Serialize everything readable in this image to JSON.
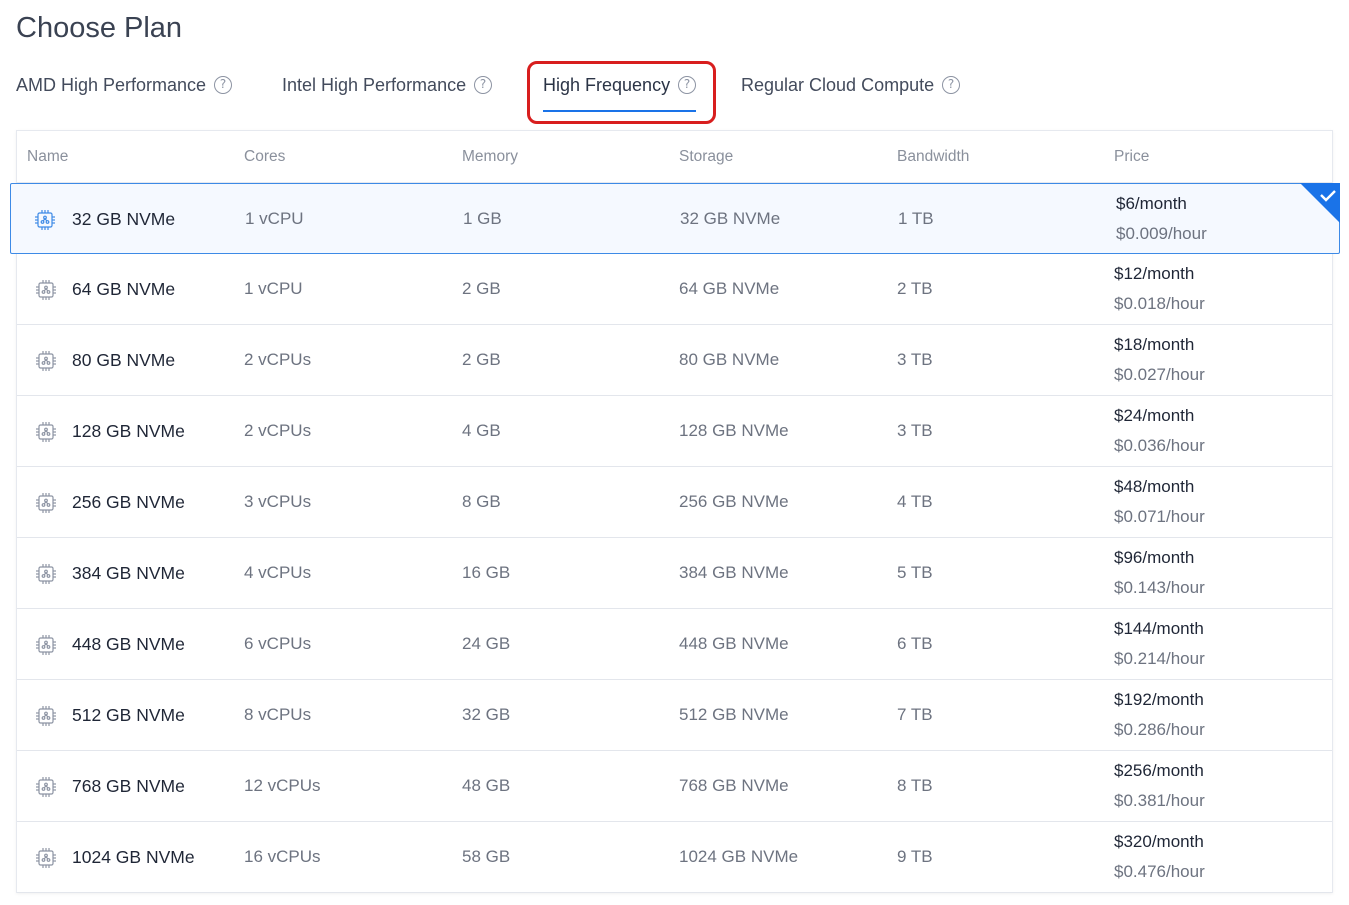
{
  "page": {
    "title": "Choose Plan"
  },
  "tabs": [
    {
      "label": "AMD High Performance",
      "help": "?"
    },
    {
      "label": "Intel High Performance",
      "help": "?"
    },
    {
      "label": "High Frequency",
      "help": "?",
      "active": true
    },
    {
      "label": "Regular Cloud Compute",
      "help": "?"
    }
  ],
  "table": {
    "headers": {
      "name": "Name",
      "cores": "Cores",
      "memory": "Memory",
      "storage": "Storage",
      "bandwidth": "Bandwidth",
      "price": "Price"
    },
    "selected_index": 0,
    "rows": [
      {
        "name": "32 GB NVMe",
        "cores": "1 vCPU",
        "memory": "1 GB",
        "storage": "32 GB NVMe",
        "bandwidth": "1 TB",
        "price_month": "$6/month",
        "price_hour": "$0.009/hour",
        "icon": "cpu-icon"
      },
      {
        "name": "64 GB NVMe",
        "cores": "1 vCPU",
        "memory": "2 GB",
        "storage": "64 GB NVMe",
        "bandwidth": "2 TB",
        "price_month": "$12/month",
        "price_hour": "$0.018/hour",
        "icon": "cpu-icon"
      },
      {
        "name": "80 GB NVMe",
        "cores": "2 vCPUs",
        "memory": "2 GB",
        "storage": "80 GB NVMe",
        "bandwidth": "3 TB",
        "price_month": "$18/month",
        "price_hour": "$0.027/hour",
        "icon": "cpu-icon"
      },
      {
        "name": "128 GB NVMe",
        "cores": "2 vCPUs",
        "memory": "4 GB",
        "storage": "128 GB NVMe",
        "bandwidth": "3 TB",
        "price_month": "$24/month",
        "price_hour": "$0.036/hour",
        "icon": "cpu-icon"
      },
      {
        "name": "256 GB NVMe",
        "cores": "3 vCPUs",
        "memory": "8 GB",
        "storage": "256 GB NVMe",
        "bandwidth": "4 TB",
        "price_month": "$48/month",
        "price_hour": "$0.071/hour",
        "icon": "cpu-icon"
      },
      {
        "name": "384 GB NVMe",
        "cores": "4 vCPUs",
        "memory": "16 GB",
        "storage": "384 GB NVMe",
        "bandwidth": "5 TB",
        "price_month": "$96/month",
        "price_hour": "$0.143/hour",
        "icon": "cpu-icon"
      },
      {
        "name": "448 GB NVMe",
        "cores": "6 vCPUs",
        "memory": "24 GB",
        "storage": "448 GB NVMe",
        "bandwidth": "6 TB",
        "price_month": "$144/month",
        "price_hour": "$0.214/hour",
        "icon": "cpu-icon"
      },
      {
        "name": "512 GB NVMe",
        "cores": "8 vCPUs",
        "memory": "32 GB",
        "storage": "512 GB NVMe",
        "bandwidth": "7 TB",
        "price_month": "$192/month",
        "price_hour": "$0.286/hour",
        "icon": "cpu-icon"
      },
      {
        "name": "768 GB NVMe",
        "cores": "12 vCPUs",
        "memory": "48 GB",
        "storage": "768 GB NVMe",
        "bandwidth": "8 TB",
        "price_month": "$256/month",
        "price_hour": "$0.381/hour",
        "icon": "cpu-icon"
      },
      {
        "name": "1024 GB NVMe",
        "cores": "16 vCPUs",
        "memory": "58 GB",
        "storage": "1024 GB NVMe",
        "bandwidth": "9 TB",
        "price_month": "$320/month",
        "price_hour": "$0.476/hour",
        "icon": "cpu-icon"
      }
    ]
  },
  "colors": {
    "accent": "#1a73e8",
    "highlight": "#d81e1e",
    "selected_border": "#3d8ae6",
    "selected_bg": "#f5f9ff"
  }
}
